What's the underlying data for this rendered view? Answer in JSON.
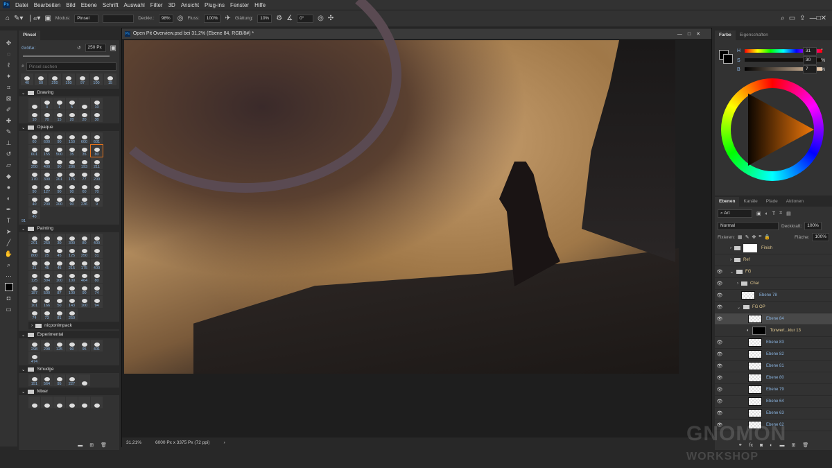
{
  "menu": [
    "Datei",
    "Bearbeiten",
    "Bild",
    "Ebene",
    "Schrift",
    "Auswahl",
    "Filter",
    "3D",
    "Ansicht",
    "Plug-ins",
    "Fenster",
    "Hilfe"
  ],
  "options": {
    "brush_size": "40",
    "modus_label": "Modus:",
    "modus": "Pinsel",
    "deckkraft_label": "Deckkr.:",
    "deckkraft": "98%",
    "fluss_label": "Fluss:",
    "fluss": "100%",
    "glaettung_label": "Glättung:",
    "glaettung": "10%",
    "angle": "0°"
  },
  "brush_panel": {
    "tab": "Pinsel",
    "size_label": "Größe:",
    "size": "250 Px",
    "search_placeholder": "Pinsel suchen",
    "recent": [
      "40",
      "50",
      "250",
      "150",
      "97",
      "100",
      "15"
    ],
    "groups": [
      {
        "name": "Drawing",
        "items": [
          "",
          "3",
          "1",
          "5",
          "",
          "10",
          "10",
          "70",
          "15",
          "20",
          "20",
          "30"
        ]
      },
      {
        "name": "Opaque",
        "items": [
          "60",
          "600",
          "90",
          "150",
          "600",
          "601",
          "601",
          "155",
          "500",
          "35",
          "35",
          "80",
          "250",
          "400",
          "90",
          "286",
          "193",
          "211",
          "170",
          "300",
          "201",
          "176",
          "77",
          "200",
          "90",
          "127",
          "90",
          "90",
          "60",
          "70",
          "40",
          "200",
          "200",
          "90",
          "236",
          "9",
          "40"
        ],
        "selected": 11
      },
      {
        "name": "Painting",
        "items": [
          "201",
          "250",
          "30",
          "300",
          "80",
          "400",
          "800",
          "25",
          "45",
          "125",
          "250",
          "31",
          "31",
          "45",
          "45",
          "215",
          "175",
          "400",
          "125",
          "394",
          "100",
          "100",
          "464",
          "80",
          "187",
          "500",
          "87",
          "100",
          "90",
          "74",
          "101",
          "166",
          "50",
          "143",
          "100",
          "94",
          "74",
          "73",
          "81",
          "250"
        ]
      },
      {
        "name": "nicponimpack",
        "collapsed": true
      },
      {
        "name": "Experimental",
        "items": [
          "298",
          "298",
          "125",
          "90",
          "95",
          "401",
          "474"
        ]
      },
      {
        "name": "Smudge",
        "items": [
          "151",
          "564",
          "95",
          "227",
          ""
        ]
      },
      {
        "name": "Mixer",
        "items": [
          "",
          "",
          "",
          "",
          "",
          ""
        ]
      }
    ],
    "above_painting": "91"
  },
  "document": {
    "title": "Open Pit Overview.psd bei 31,2% (Ebene 84, RGB/8#) *",
    "zoom": "31,21%",
    "dimensions": "6000 Px x 3375 Px (72 ppi)"
  },
  "color_panel": {
    "tabs": [
      "Farbe",
      "Eigenschaften"
    ],
    "h_label": "H",
    "s_label": "S",
    "b_label": "B",
    "h": "31",
    "s": "30",
    "b": "7",
    "h_unit": "°",
    "s_unit": "%",
    "b_unit": "%",
    "foreground": "#120f0d",
    "accent": "#f0780a"
  },
  "layers_panel": {
    "tabs": [
      "Ebenen",
      "Kanäle",
      "Pfade",
      "Aktionen"
    ],
    "filter": "Art",
    "blend": "Normal",
    "opacity_label": "Deckkraft:",
    "opacity": "100%",
    "lock_label": "Fixieren:",
    "fill_label": "Fläche:",
    "fill": "100%",
    "layers": [
      {
        "name": "Finish",
        "type": "group",
        "visible": false,
        "indent": 0
      },
      {
        "name": "Ref",
        "type": "group",
        "visible": false,
        "indent": 0
      },
      {
        "name": "FG",
        "type": "group",
        "visible": true,
        "indent": 0,
        "open": true
      },
      {
        "name": "Char",
        "type": "group",
        "visible": true,
        "indent": 1
      },
      {
        "name": "Ebene 78",
        "type": "layer",
        "visible": true,
        "indent": 1
      },
      {
        "name": "FG OP",
        "type": "group",
        "visible": true,
        "indent": 1,
        "open": true
      },
      {
        "name": "Ebene 84",
        "type": "layer",
        "visible": true,
        "indent": 2,
        "selected": true
      },
      {
        "name": "Tonwert...ktur 13",
        "type": "adjustment",
        "visible": false,
        "indent": 2
      },
      {
        "name": "Ebene 83",
        "type": "layer",
        "visible": true,
        "indent": 2
      },
      {
        "name": "Ebene 82",
        "type": "layer",
        "visible": true,
        "indent": 2
      },
      {
        "name": "Ebene 81",
        "type": "layer",
        "visible": true,
        "indent": 2
      },
      {
        "name": "Ebene 80",
        "type": "layer",
        "visible": true,
        "indent": 2
      },
      {
        "name": "Ebene 79",
        "type": "layer",
        "visible": true,
        "indent": 2
      },
      {
        "name": "Ebene 64",
        "type": "layer",
        "visible": true,
        "indent": 2
      },
      {
        "name": "Ebene 63",
        "type": "layer",
        "visible": true,
        "indent": 2
      },
      {
        "name": "Ebene 62",
        "type": "layer",
        "visible": true,
        "indent": 2
      }
    ]
  },
  "watermark": "THE GNOMON WORKSHOP"
}
